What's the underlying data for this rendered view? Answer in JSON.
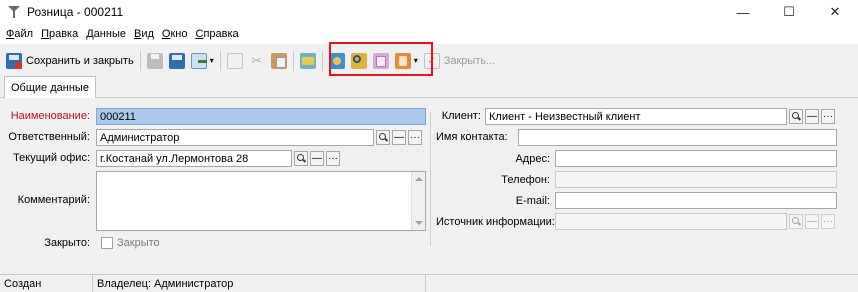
{
  "window": {
    "title": "Розница - 000211",
    "controls": {
      "minimize": "—",
      "maximize": "☐",
      "close": "✕"
    }
  },
  "menu": {
    "items": [
      {
        "label": "Файл",
        "u": "Ф",
        "rest": "айл"
      },
      {
        "label": "Правка",
        "u": "П",
        "rest": "равка"
      },
      {
        "label": "Данные",
        "u": "Д",
        "rest": "анные"
      },
      {
        "label": "Вид",
        "u": "В",
        "rest": "ид"
      },
      {
        "label": "Окно",
        "u": "О",
        "rest": "кно"
      },
      {
        "label": "Справка",
        "u": "С",
        "rest": "правка"
      }
    ]
  },
  "toolbar": {
    "save_close_label": "Сохранить и закрыть",
    "close_label": "Закрыть...",
    "dropdown_glyph": "▾",
    "colors": {
      "highlight": "#e0141e"
    }
  },
  "tabs": [
    {
      "label": "Общие данные"
    }
  ],
  "form": {
    "left": {
      "name_label": "Наименование:",
      "name_value": "000211",
      "responsible_label": "Ответственный:",
      "responsible_value": "Администратор",
      "office_label": "Текущий офис:",
      "office_value": "г.Костанай ул.Лермонтова 28",
      "comment_label": "Комментарий:",
      "comment_value": "",
      "closed_label": "Закрыто:",
      "closed_checkbox_label": "Закрыто",
      "closed_checked": false
    },
    "right": {
      "client_label": "Клиент:",
      "client_value": "Клиент - Неизвестный клиент",
      "contact_label": "Имя контакта:",
      "contact_value": "",
      "address_label": "Адрес:",
      "address_value": "",
      "phone_label": "Телефон:",
      "phone_value": "",
      "email_label": "E-mail:",
      "email_value": "",
      "source_label": "Источник информации:",
      "source_value": ""
    },
    "field_buttons": {
      "clear": "—",
      "more": "···"
    }
  },
  "status": {
    "created": "Создан",
    "owner": "Владелец: Администратор"
  },
  "icons": {
    "app": "cocktail-icon",
    "save_close": "save-close-icon",
    "print": "print-icon",
    "save": "save-icon",
    "export": "export-icon",
    "copy": "copy-icon",
    "cut": "cut-icon",
    "paste": "paste-icon",
    "book": "book-icon",
    "card": "card-icon",
    "search_doc": "search-document-icon",
    "docs": "documents-icon",
    "contact": "contact-card-icon",
    "close_doc": "close-document-icon",
    "search": "search-icon",
    "location": "location-pin-icon",
    "edit": "pencil-icon"
  }
}
